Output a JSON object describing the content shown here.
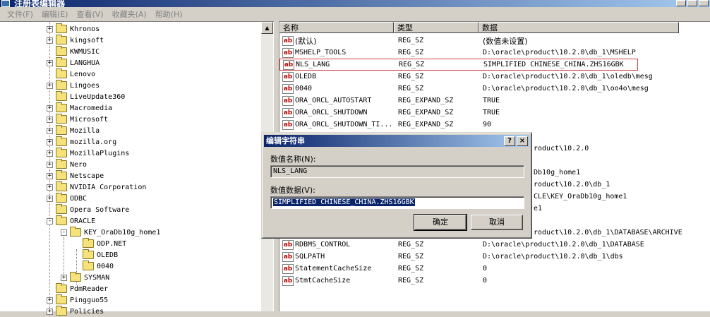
{
  "window": {
    "title": "注册表编辑器"
  },
  "menu": [
    "文件(F)",
    "编辑(E)",
    "查看(V)",
    "收藏夹(A)",
    "帮助(H)"
  ],
  "tree": [
    {
      "label": "Khronos",
      "level": 1,
      "expander": "+"
    },
    {
      "label": "kingsoft",
      "level": 1,
      "expander": "+"
    },
    {
      "label": "KWMUSIC",
      "level": 1,
      "expander": ""
    },
    {
      "label": "LANGHUA",
      "level": 1,
      "expander": "+"
    },
    {
      "label": "Lenovo",
      "level": 1,
      "expander": ""
    },
    {
      "label": "Lingoes",
      "level": 1,
      "expander": "+"
    },
    {
      "label": "LiveUpdate360",
      "level": 1,
      "expander": ""
    },
    {
      "label": "Macromedia",
      "level": 1,
      "expander": "+"
    },
    {
      "label": "Microsoft",
      "level": 1,
      "expander": "+"
    },
    {
      "label": "Mozilla",
      "level": 1,
      "expander": "+"
    },
    {
      "label": "mozilla.org",
      "level": 1,
      "expander": "+"
    },
    {
      "label": "MozillaPlugins",
      "level": 1,
      "expander": "+"
    },
    {
      "label": "Nero",
      "level": 1,
      "expander": "+"
    },
    {
      "label": "Netscape",
      "level": 1,
      "expander": "+"
    },
    {
      "label": "NVIDIA Corporation",
      "level": 1,
      "expander": "+"
    },
    {
      "label": "ODBC",
      "level": 1,
      "expander": "+"
    },
    {
      "label": "Opera Software",
      "level": 1,
      "expander": ""
    },
    {
      "label": "ORACLE",
      "level": 1,
      "expander": "-"
    },
    {
      "label": "KEY_OraDb10g_home1",
      "level": 2,
      "expander": "-"
    },
    {
      "label": "ODP.NET",
      "level": 3,
      "expander": ""
    },
    {
      "label": "OLEDB",
      "level": 3,
      "expander": ""
    },
    {
      "label": "0040",
      "level": 3,
      "expander": ""
    },
    {
      "label": "SYSMAN",
      "level": 2,
      "expander": "+"
    },
    {
      "label": "PdmReader",
      "level": 1,
      "expander": ""
    },
    {
      "label": "Pingguo55",
      "level": 1,
      "expander": "+"
    },
    {
      "label": "Policies",
      "level": 1,
      "expander": "+"
    }
  ],
  "list": {
    "columns": [
      "名称",
      "类型",
      "数据"
    ],
    "rows": [
      {
        "name": "(默认)",
        "type": "REG_SZ",
        "data": "(数值未设置)",
        "cjk": true
      },
      {
        "name": "MSHELP_TOOLS",
        "type": "REG_SZ",
        "data": "D:\\oracle\\product\\10.2.0\\db_1\\MSHELP"
      },
      {
        "name": "NLS_LANG",
        "type": "REG_SZ",
        "data": "SIMPLIFIED CHINESE_CHINA.ZHS16GBK",
        "selected": true
      },
      {
        "name": "OLEDB",
        "type": "REG_SZ",
        "data": "D:\\oracle\\product\\10.2.0\\db_1\\oledb\\mesg"
      },
      {
        "name": "0040",
        "type": "REG_SZ",
        "data": "D:\\oracle\\product\\10.2.0\\db_1\\oo4o\\mesg"
      },
      {
        "name": "ORA_ORCL_AUTOSTART",
        "type": "REG_EXPAND_SZ",
        "data": "TRUE"
      },
      {
        "name": "ORA_ORCL_SHUTDOWN",
        "type": "REG_EXPAND_SZ",
        "data": "TRUE"
      },
      {
        "name": "ORA_ORCL_SHUTDOWN_TI...",
        "type": "REG_EXPAND_SZ",
        "data": "90"
      },
      {
        "name": "",
        "type": "",
        "data": "",
        "hidden": true
      },
      {
        "name": "",
        "type": "",
        "data": "roduct\\10.2.0",
        "partial": true
      },
      {
        "name": "",
        "type": "",
        "data": "",
        "hidden": true
      },
      {
        "name": "",
        "type": "",
        "data": "Db10g_home1",
        "partial": true
      },
      {
        "name": "",
        "type": "",
        "data": "roduct\\10.2.0\\db_1",
        "partial": true
      },
      {
        "name": "",
        "type": "",
        "data": "CLE\\KEY_OraDb10g_home1",
        "partial": true
      },
      {
        "name": "",
        "type": "",
        "data": "e1",
        "partial": true
      },
      {
        "name": "",
        "type": "",
        "data": "",
        "hidden": true
      },
      {
        "name": "",
        "type": "",
        "data": "roduct\\10.2.0\\db_1\\DATABASE\\ARCHIVE",
        "partial": true
      },
      {
        "name": "RDBMS_CONTROL",
        "type": "REG_SZ",
        "data": "D:\\oracle\\product\\10.2.0\\db_1\\DATABASE"
      },
      {
        "name": "SQLPATH",
        "type": "REG_SZ",
        "data": "D:\\oracle\\product\\10.2.0\\db_1\\dbs"
      },
      {
        "name": "StatementCacheSize",
        "type": "REG_SZ",
        "data": "0"
      },
      {
        "name": "StmtCacheSize",
        "type": "REG_SZ",
        "data": "0"
      }
    ]
  },
  "dialog": {
    "title": "编辑字符串",
    "help_btn": "?",
    "close_btn": "×",
    "name_label": "数值名称(N):",
    "name_value": "NLS_LANG",
    "data_label": "数值数据(V):",
    "data_value": "SIMPLIFIED CHINESE_CHINA.ZHS16GBK",
    "ok_label": "确定",
    "cancel_label": "取消"
  },
  "icons": {
    "string_value": "ab",
    "folder": "folder-icon"
  }
}
